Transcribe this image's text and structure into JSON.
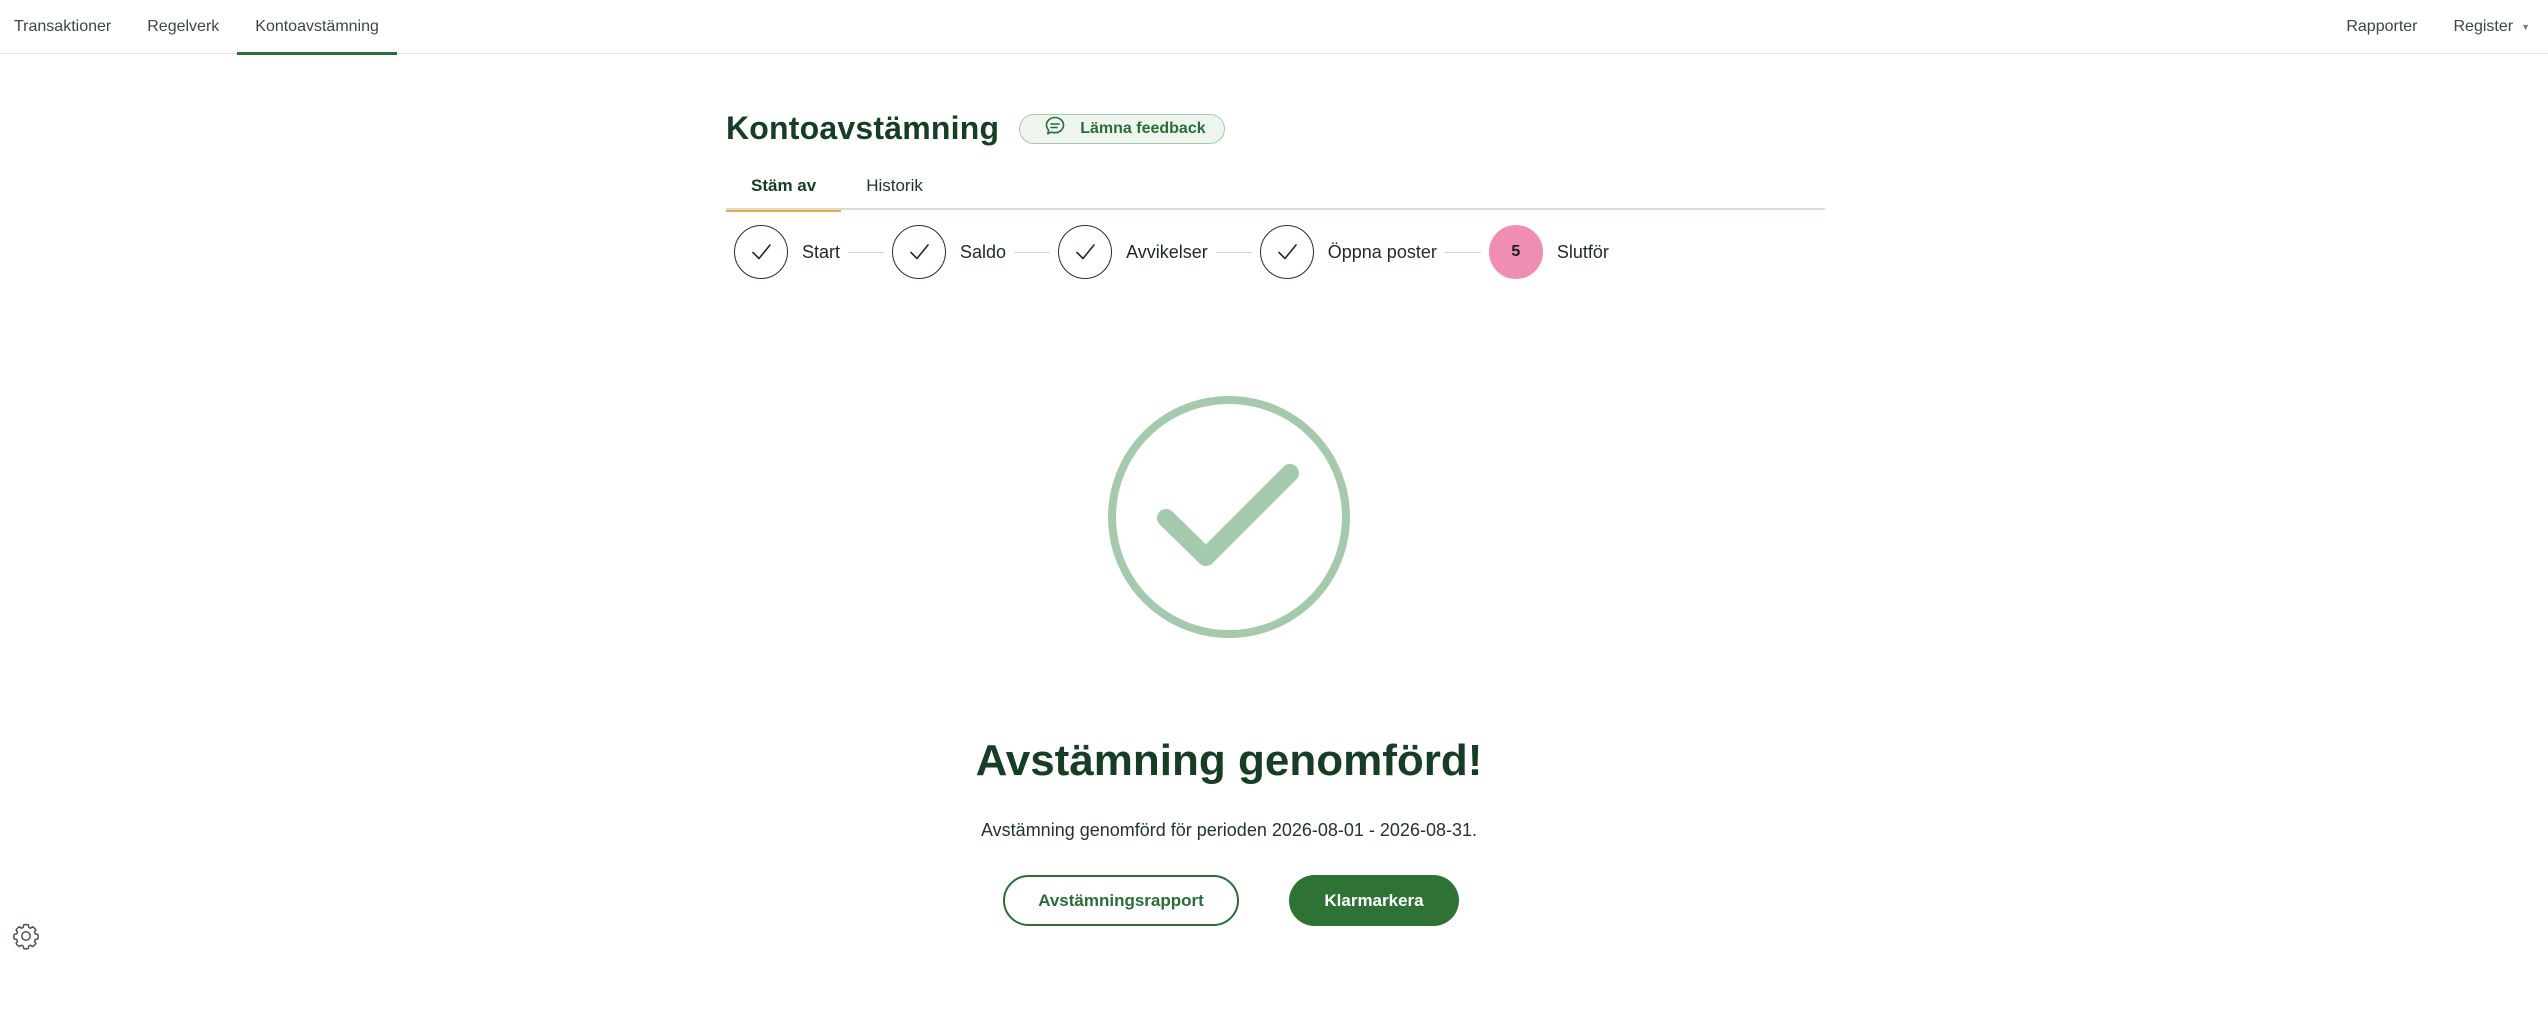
{
  "nav": {
    "left": [
      "Transaktioner",
      "Regelverk",
      "Kontoavstämning"
    ],
    "right": {
      "reports": "Rapporter",
      "register": "Register"
    }
  },
  "page": {
    "title": "Kontoavstämning",
    "feedback_label": "Lämna feedback"
  },
  "tabs": [
    "Stäm av",
    "Historik"
  ],
  "steps": {
    "s1": "Start",
    "s2": "Saldo",
    "s3": "Avvikelser",
    "s4": "Öppna poster",
    "s5_number": "5",
    "s5": "Slutför"
  },
  "result": {
    "heading": "Avstämning genomförd!",
    "message": "Avstämning genomförd för perioden 2026-08-01 - 2026-08-31.",
    "report_button": "Avstämningsrapport",
    "complete_button": "Klarmarkera"
  },
  "colors": {
    "brand_green": "#2e7235",
    "success_green": "#a5c9ac",
    "current_step_pink": "#ef8db3",
    "active_tab_underline": "#e0b03a"
  },
  "icons": [
    "chat-bubble-icon",
    "checkmark-icon",
    "success-check-icon",
    "gear-icon",
    "chevron-down-icon"
  ]
}
